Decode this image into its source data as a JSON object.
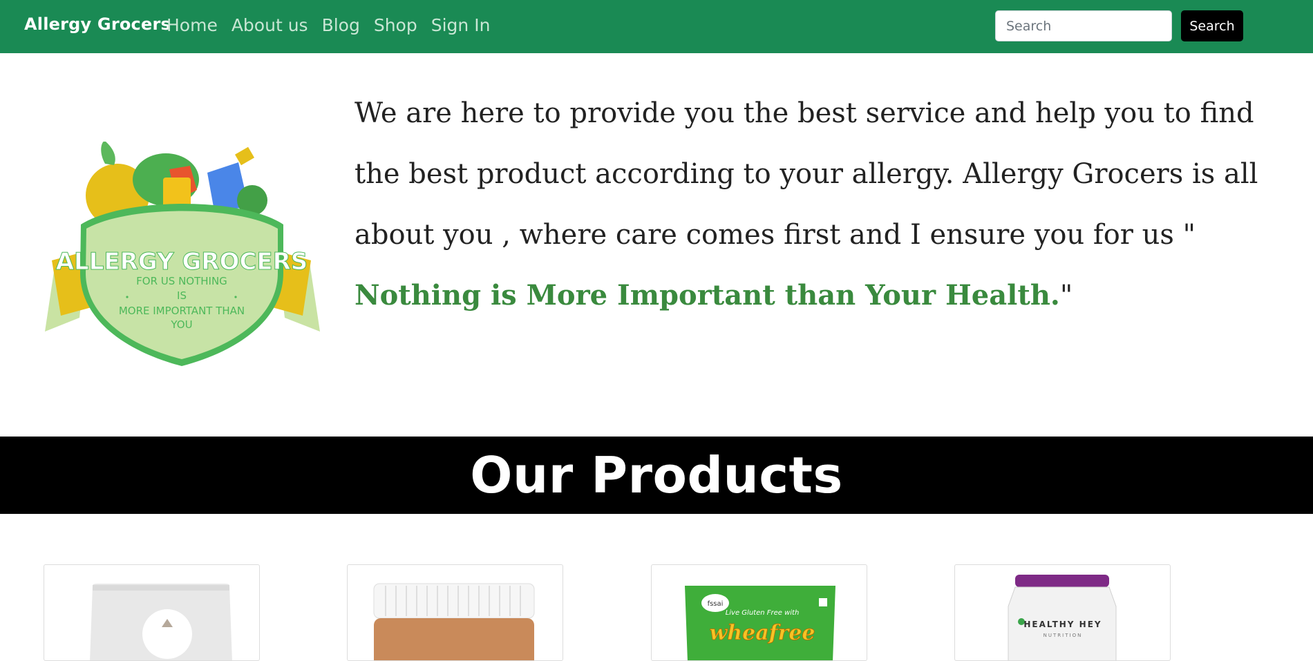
{
  "navbar": {
    "brand": "Allergy Grocers",
    "links": [
      "Home",
      "About us",
      "Blog",
      "Shop",
      "Sign In"
    ],
    "search_placeholder": "Search",
    "search_button": "Search",
    "background_color": "#1a8a54"
  },
  "hero": {
    "logo": {
      "title": "ALLERGY GROCERS",
      "tagline_line1": "FOR US NOTHING",
      "tagline_line2": "IS",
      "tagline_line3": "MORE IMPORTANT THAN",
      "tagline_line4": "YOU"
    },
    "text_before": "We are here to provide you the best service and help you to find the best product according to your allergy. Allergy Grocers is all about you , where care comes first and I ensure you for us \" ",
    "text_emphasis": "Nothing is More Important than Your Health.",
    "text_after": "\"",
    "emphasis_color": "#3a8a3e"
  },
  "products": {
    "heading": "Our Products",
    "items": [
      {
        "name": "pouch",
        "visible_text": ""
      },
      {
        "name": "peanut-butter-jar",
        "visible_text": ""
      },
      {
        "name": "wheafree-pack",
        "visible_text": "wheafree",
        "badge": "fssai",
        "tagline": "Live Gluten Free with"
      },
      {
        "name": "protein-tub",
        "visible_text": "HEALTHY HEY",
        "subtext": "NUTRITION"
      }
    ]
  }
}
